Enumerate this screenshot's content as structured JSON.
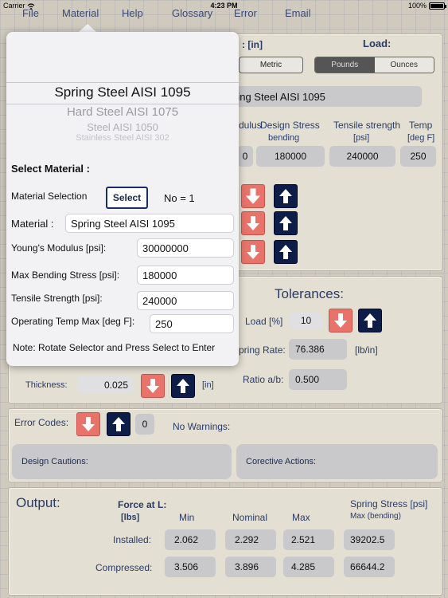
{
  "status": {
    "carrier": "Carrier",
    "time": "4:23 PM",
    "battery": "100%"
  },
  "menu": [
    "File",
    "Material",
    "Help",
    "Glossary",
    "Error",
    "Email"
  ],
  "units": {
    "label_suffix": ": [in]",
    "metric": "Metric"
  },
  "load": {
    "title": "Load:",
    "pounds": "Pounds",
    "ounces": "Ounces"
  },
  "material_banner": "ring Steel AISI 1095",
  "properties": {
    "modulus_label": "dulus",
    "design_stress_label": "Design Stress",
    "design_stress_sub": "bending",
    "tensile_label": "Tensile strength",
    "tensile_sub": "[psi]",
    "temp_label": "Temp",
    "temp_sub": "[deg F]",
    "modulus_value": "0",
    "design_stress_value": "180000",
    "tensile_value": "240000",
    "temp_value": "250"
  },
  "tolerances": {
    "title": "Tolerances:",
    "load_label": "Load [%]",
    "load_value": "10",
    "spring_rate_label": "pring Rate:",
    "spring_rate_value": "76.386",
    "spring_rate_unit": "[lb/in]",
    "ratio_label": "Ratio a/b:",
    "ratio_value": "0.500"
  },
  "thickness": {
    "label": "Thickness:",
    "value": "0.025",
    "unit": "[in]"
  },
  "errors": {
    "label": "Error Codes:",
    "count": "0",
    "warnings": "No Warnings:",
    "design_cautions": "Design Cautions:",
    "corrective_actions": "Corective Actions:"
  },
  "output": {
    "title": "Output:",
    "force_label": "Force at L:",
    "force_unit": "[lbs]",
    "col_min": "Min",
    "col_nominal": "Nominal",
    "col_max": "Max",
    "stress_label": "Spring Stress [psi]",
    "stress_sub": "Max (bending)",
    "rows": [
      {
        "label": "Installed:",
        "min": "2.062",
        "nominal": "2.292",
        "max": "2.521",
        "stress": "39202.5"
      },
      {
        "label": "Compressed:",
        "min": "3.506",
        "nominal": "3.896",
        "max": "4.285",
        "stress": "66644.2"
      }
    ]
  },
  "popover": {
    "picker": [
      "Spring Steel AISI 1095",
      "Hard Steel AISI 1075",
      "Steel AISI 1050",
      "Stainless Steel AISI 302"
    ],
    "select_title": "Select Material :",
    "selection_label": "Material Selection",
    "select_button": "Select",
    "selection_no": "No = 1",
    "material_label": "Material  :",
    "material_value": "Spring Steel AISI 1095",
    "youngs_label": "Young's Modulus [psi]:",
    "youngs_value": "30000000",
    "bending_label": "Max Bending Stress [psi]:",
    "bending_value": "180000",
    "tensile_label": "Tensile Strength [psi]:",
    "tensile_value": "240000",
    "temp_label": "Operating Temp Max [deg F]:",
    "temp_value": "250",
    "note": "Note:   Rotate Selector and Press Select to Enter"
  },
  "colors": {
    "arrow_down": "#e8736a",
    "arrow_up": "#0e1c48",
    "panel": "#e4dfd3"
  }
}
